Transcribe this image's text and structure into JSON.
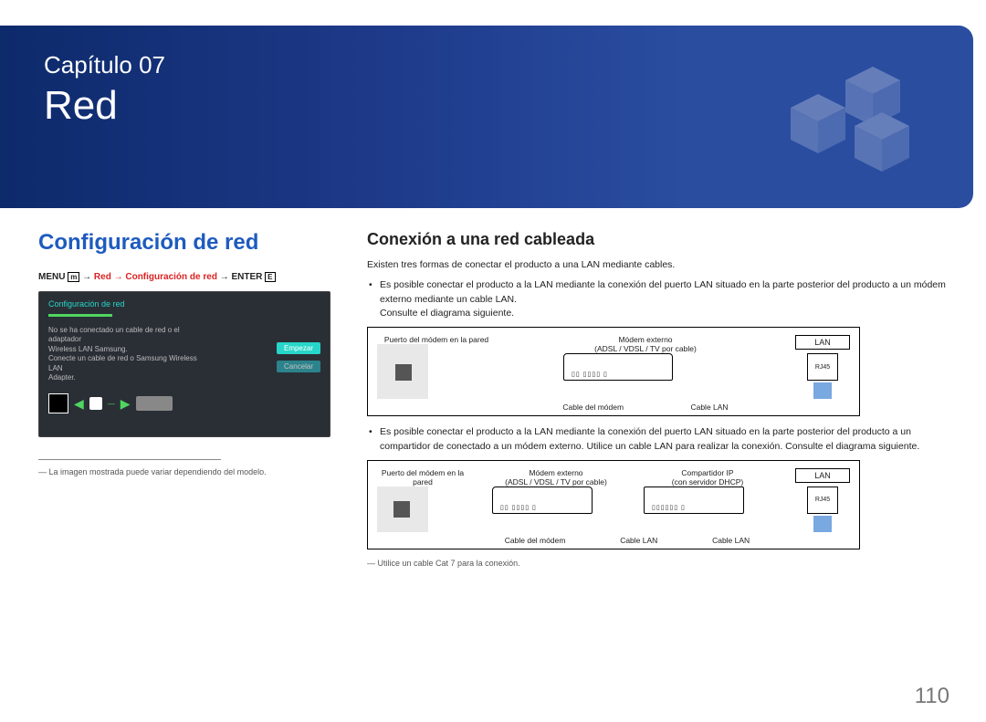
{
  "header": {
    "chapter_label": "Capítulo 07",
    "chapter_title": "Red"
  },
  "left": {
    "section_heading": "Configuración de red",
    "menu_path": {
      "prefix": "MENU",
      "icon1": "m",
      "arrow": " → ",
      "red_part": "Red → Configuración de red",
      "suffix": " → ENTER",
      "icon2": "E"
    },
    "osd": {
      "title": "Configuración de red",
      "text_line1": "No se ha conectado un cable de red o el adaptador",
      "text_line2": "Wireless LAN Samsung.",
      "text_line3": "Conecte un cable de red o Samsung Wireless LAN",
      "text_line4": "Adapter.",
      "start_btn": "Empezar",
      "cancel_btn": "Cancelar"
    },
    "footnote": "La imagen mostrada puede variar dependiendo del modelo."
  },
  "right": {
    "sub_heading": "Conexión a una red cableada",
    "intro": "Existen tres formas de conectar el producto a una LAN mediante cables.",
    "bullet1a": "Es posible conectar el producto a la LAN mediante la conexión del puerto LAN situado en la parte posterior del producto a un módem externo mediante un cable LAN.",
    "bullet1b": "Consulte el diagrama siguiente.",
    "diagram1": {
      "wall_label": "Puerto del módem en la pared",
      "modem_label": "Módem externo",
      "modem_sub": "(ADSL / VDSL / TV por cable)",
      "cable1": "Cable del módem",
      "cable2": "Cable LAN",
      "lan": "LAN",
      "rj45": "RJ45"
    },
    "bullet2": "Es posible conectar el producto a la LAN mediante la conexión del puerto LAN situado en la parte posterior del producto a un compartidor de conectado a un módem externo. Utilice un cable LAN para realizar la conexión. Consulte el diagrama siguiente.",
    "diagram2": {
      "wall_label": "Puerto del módem en la pared",
      "modem_label": "Módem externo",
      "modem_sub": "(ADSL / VDSL / TV por cable)",
      "router_label": "Compartidor IP",
      "router_sub": "(con servidor DHCP)",
      "cable1": "Cable del módem",
      "cable2": "Cable LAN",
      "cable3": "Cable LAN",
      "lan": "LAN",
      "rj45": "RJ45"
    },
    "cat7_note": "Utilice un cable Cat 7 para la conexión."
  },
  "page_number": "110"
}
